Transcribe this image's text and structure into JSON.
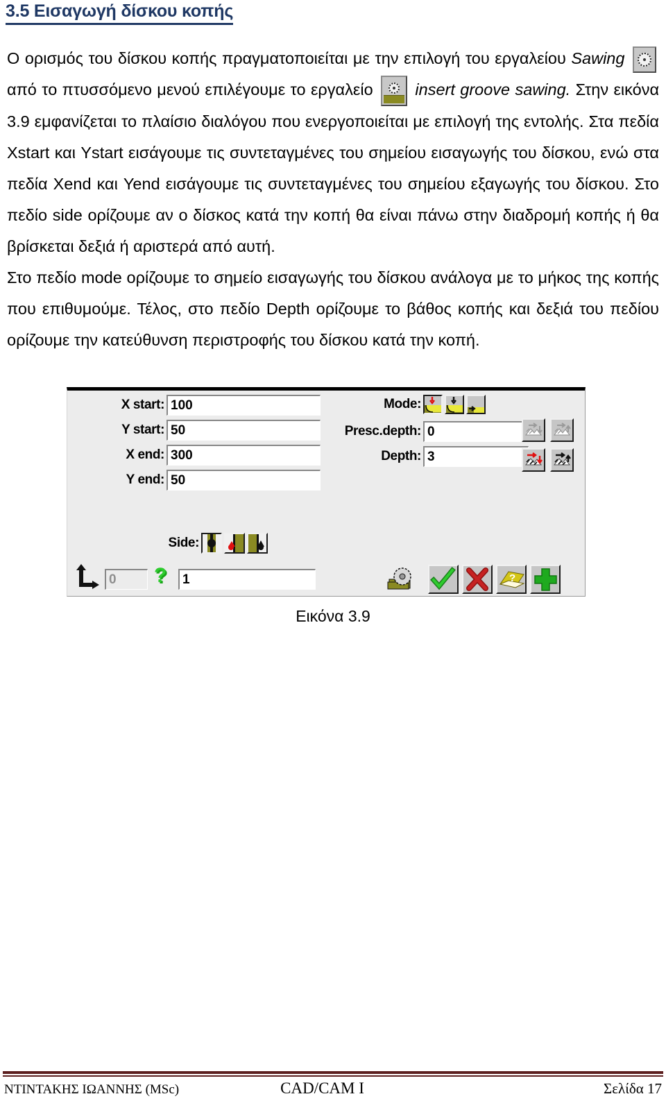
{
  "heading": "3.5 Εισαγωγή δίσκου κοπής",
  "paragraph": {
    "seg1": "Ο ορισμός του δίσκου κοπής πραγματοποιείται με την επιλογή του εργαλείου",
    "seg_sawing": "Sawing",
    "seg2": "από το πτυσσόμενο μενού επιλέγουμε το εργαλείο",
    "seg_insert": "insert groove sawing.",
    "seg3": "Στην εικόνα 3.9 εμφανίζεται το πλαίσιο διαλόγου που ενεργοποιείται με επιλογή της εντολής. Στα πεδία Xstart και Ystart εισάγουμε τις συντεταγμένες του σημείου εισαγωγής του δίσκου, ενώ στα πεδία Xend και Yend εισάγουμε τις συντεταγμένες του σημείου εξαγωγής του δίσκου. Στο πεδίο side ορίζουμε αν ο δίσκος κατά την κοπή θα είναι πάνω στην διαδρομή κοπής ή θα βρίσκεται δεξιά ή αριστερά από αυτή.",
    "seg4": "Στο πεδίο mode ορίζουμε το σημείο εισαγωγής του δίσκου ανάλογα με το μήκος της κοπής που επιθυμούμε. Τέλος, στο πεδίο Depth ορίζουμε το βάθος κοπής και δεξιά του πεδίου ορίζουμε την κατεύθυνση περιστροφής του δίσκου κατά την κοπή."
  },
  "icons": {
    "sawing_tool": "saw-blade-icon",
    "insert_groove_sawing_tool": "saw-blade-on-stock-icon"
  },
  "dialog": {
    "left_fields": [
      {
        "label": "X start:",
        "value": "100"
      },
      {
        "label": "Y start:",
        "value": "50"
      },
      {
        "label": "X end:",
        "value": "300"
      },
      {
        "label": "Y end:",
        "value": "50"
      }
    ],
    "mode": {
      "label": "Mode:",
      "buttons": [
        {
          "name": "mode-plunge-down",
          "selected": true
        },
        {
          "name": "mode-plunge-down-black",
          "selected": false
        },
        {
          "name": "mode-enter-from-side",
          "selected": false
        }
      ]
    },
    "presc_depth": {
      "label": "Presc.depth:",
      "value": "0"
    },
    "depth": {
      "label": "Depth:",
      "value": "3"
    },
    "rotation_buttons": [
      {
        "name": "rotation-down-left-disabled",
        "enabled": false
      },
      {
        "name": "rotation-down-right-disabled",
        "enabled": false
      },
      {
        "name": "rotation-climb-cut",
        "enabled": true
      },
      {
        "name": "rotation-conventional-cut",
        "enabled": true
      }
    ],
    "side": {
      "label": "Side:",
      "buttons": [
        {
          "name": "side-on-path",
          "selected": true
        },
        {
          "name": "side-left",
          "selected": false
        },
        {
          "name": "side-right",
          "selected": false
        }
      ]
    },
    "bottom": {
      "index_value": "0",
      "help_value": "1",
      "tool_icon": "saw-blade-on-stock-icon",
      "ok": "check-icon",
      "cancel": "red-x-icon",
      "help": "yellow-book-help-icon",
      "add": "green-plus-icon"
    }
  },
  "caption": "Εικόνα 3.9",
  "footer": {
    "author": "ΝΤΙΝΤΑΚΗΣ ΙΩΑΝΝΗΣ (MSc)",
    "course": "CAD/CAM I",
    "page": "Σελίδα 17"
  },
  "colors": {
    "heading": "#1F3864",
    "footer_rule": "#5C1F1F",
    "dialog_bg": "#ECECEC",
    "stock_yellow": "#8A8A22",
    "hatch_yellow": "#E8E83A",
    "ok_green": "#1FA01F",
    "cancel_red": "#B51B1B",
    "help_yellow": "#D4C617"
  }
}
